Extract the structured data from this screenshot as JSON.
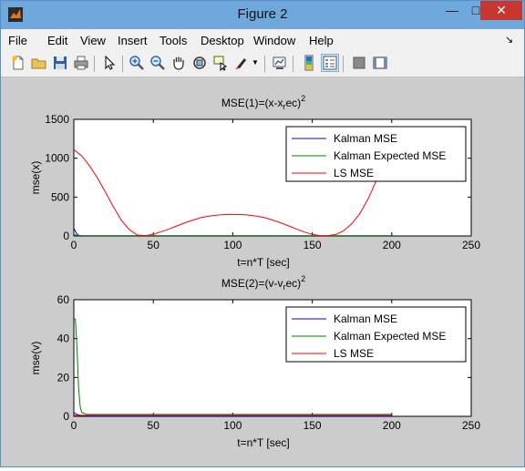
{
  "window": {
    "title": "Figure 2",
    "minimize_label": "—",
    "maximize_label": "□",
    "close_label": "✕"
  },
  "menu": [
    "File",
    "Edit",
    "View",
    "Insert",
    "Tools",
    "Desktop",
    "Window",
    "Help"
  ],
  "toolbar": [
    "new-figure-icon",
    "open-file-icon",
    "save-icon",
    "print-icon",
    "edit-plot-pointer-icon",
    "zoom-in-icon",
    "zoom-out-icon",
    "pan-hand-icon",
    "rotate-3d-icon",
    "data-cursor-icon",
    "brush-icon",
    "brush-dropdown-icon",
    "link-plot-icon",
    "insert-colorbar-icon",
    "insert-legend-icon",
    "hide-plot-tools-icon",
    "show-plot-tools-icon"
  ],
  "colors": {
    "kalman": "#0000ff",
    "kalman_expected": "#008000",
    "ls": "#ff0000"
  },
  "chart_data": [
    {
      "type": "line",
      "title": "MSE(1)=(x-x_rec)²",
      "title_parts": {
        "main": "MSE(1)=(x-x",
        "sub": "r",
        "after": "ec)",
        "sup": "2"
      },
      "xlabel": "t=n*T [sec]",
      "ylabel": "mse(x)",
      "xlim": [
        0,
        250
      ],
      "ylim": [
        0,
        1500
      ],
      "xticks": [
        "0",
        "50",
        "100",
        "150",
        "200",
        "250"
      ],
      "yticks": [
        "0",
        "500",
        "1000",
        "1500"
      ],
      "legend_position": "top-right",
      "series": [
        {
          "name": "Kalman MSE",
          "color": "#0000ff",
          "points": [
            [
              0,
              100
            ],
            [
              1,
              60
            ],
            [
              2,
              25
            ],
            [
              3,
              8
            ],
            [
              5,
              2
            ],
            [
              10,
              1
            ],
            [
              200,
              1
            ]
          ]
        },
        {
          "name": "Kalman Expected MSE",
          "color": "#008000",
          "points": [
            [
              0,
              20
            ],
            [
              2,
              8
            ],
            [
              4,
              3
            ],
            [
              8,
              2
            ],
            [
              200,
              2
            ]
          ]
        },
        {
          "name": "LS MSE",
          "color": "#ff0000",
          "points": [
            [
              0,
              1110
            ],
            [
              5,
              1030
            ],
            [
              10,
              900
            ],
            [
              15,
              740
            ],
            [
              20,
              560
            ],
            [
              25,
              370
            ],
            [
              30,
              200
            ],
            [
              35,
              80
            ],
            [
              40,
              12
            ],
            [
              45,
              5
            ],
            [
              50,
              20
            ],
            [
              55,
              55
            ],
            [
              60,
              90
            ],
            [
              65,
              130
            ],
            [
              70,
              170
            ],
            [
              75,
              205
            ],
            [
              80,
              235
            ],
            [
              85,
              255
            ],
            [
              90,
              268
            ],
            [
              95,
              275
            ],
            [
              100,
              277
            ],
            [
              105,
              275
            ],
            [
              110,
              268
            ],
            [
              115,
              255
            ],
            [
              120,
              235
            ],
            [
              125,
              205
            ],
            [
              130,
              170
            ],
            [
              135,
              130
            ],
            [
              140,
              90
            ],
            [
              145,
              50
            ],
            [
              150,
              20
            ],
            [
              155,
              4
            ],
            [
              160,
              5
            ],
            [
              165,
              20
            ],
            [
              170,
              70
            ],
            [
              175,
              160
            ],
            [
              180,
              290
            ],
            [
              185,
              470
            ],
            [
              190,
              700
            ],
            [
              195,
              980
            ],
            [
              198,
              1180
            ],
            [
              200,
              1300
            ]
          ]
        }
      ]
    },
    {
      "type": "line",
      "title": "MSE(2)=(v-v_rec)²",
      "title_parts": {
        "main": "MSE(2)=(v-v",
        "sub": "r",
        "after": "ec)",
        "sup": "2"
      },
      "xlabel": "t=n*T [sec]",
      "ylabel": "mse(v)",
      "xlim": [
        0,
        250
      ],
      "ylim": [
        0,
        60
      ],
      "xticks": [
        "0",
        "50",
        "100",
        "150",
        "200",
        "250"
      ],
      "yticks": [
        "0",
        "20",
        "40",
        "60"
      ],
      "legend_position": "top-right",
      "series": [
        {
          "name": "Kalman MSE",
          "color": "#0000ff",
          "points": [
            [
              0,
              2
            ],
            [
              2,
              1
            ],
            [
              4,
              0.5
            ],
            [
              10,
              0.2
            ],
            [
              200,
              0.2
            ]
          ]
        },
        {
          "name": "Kalman Expected MSE",
          "color": "#008000",
          "points": [
            [
              0,
              50
            ],
            [
              1,
              50
            ],
            [
              2,
              35
            ],
            [
              3,
              15
            ],
            [
              4,
              5
            ],
            [
              5,
              2
            ],
            [
              8,
              1
            ],
            [
              200,
              1
            ]
          ]
        },
        {
          "name": "LS MSE",
          "color": "#ff0000",
          "points": [
            [
              0,
              0.5
            ],
            [
              10,
              0.5
            ],
            [
              200,
              0.5
            ]
          ]
        }
      ]
    }
  ]
}
